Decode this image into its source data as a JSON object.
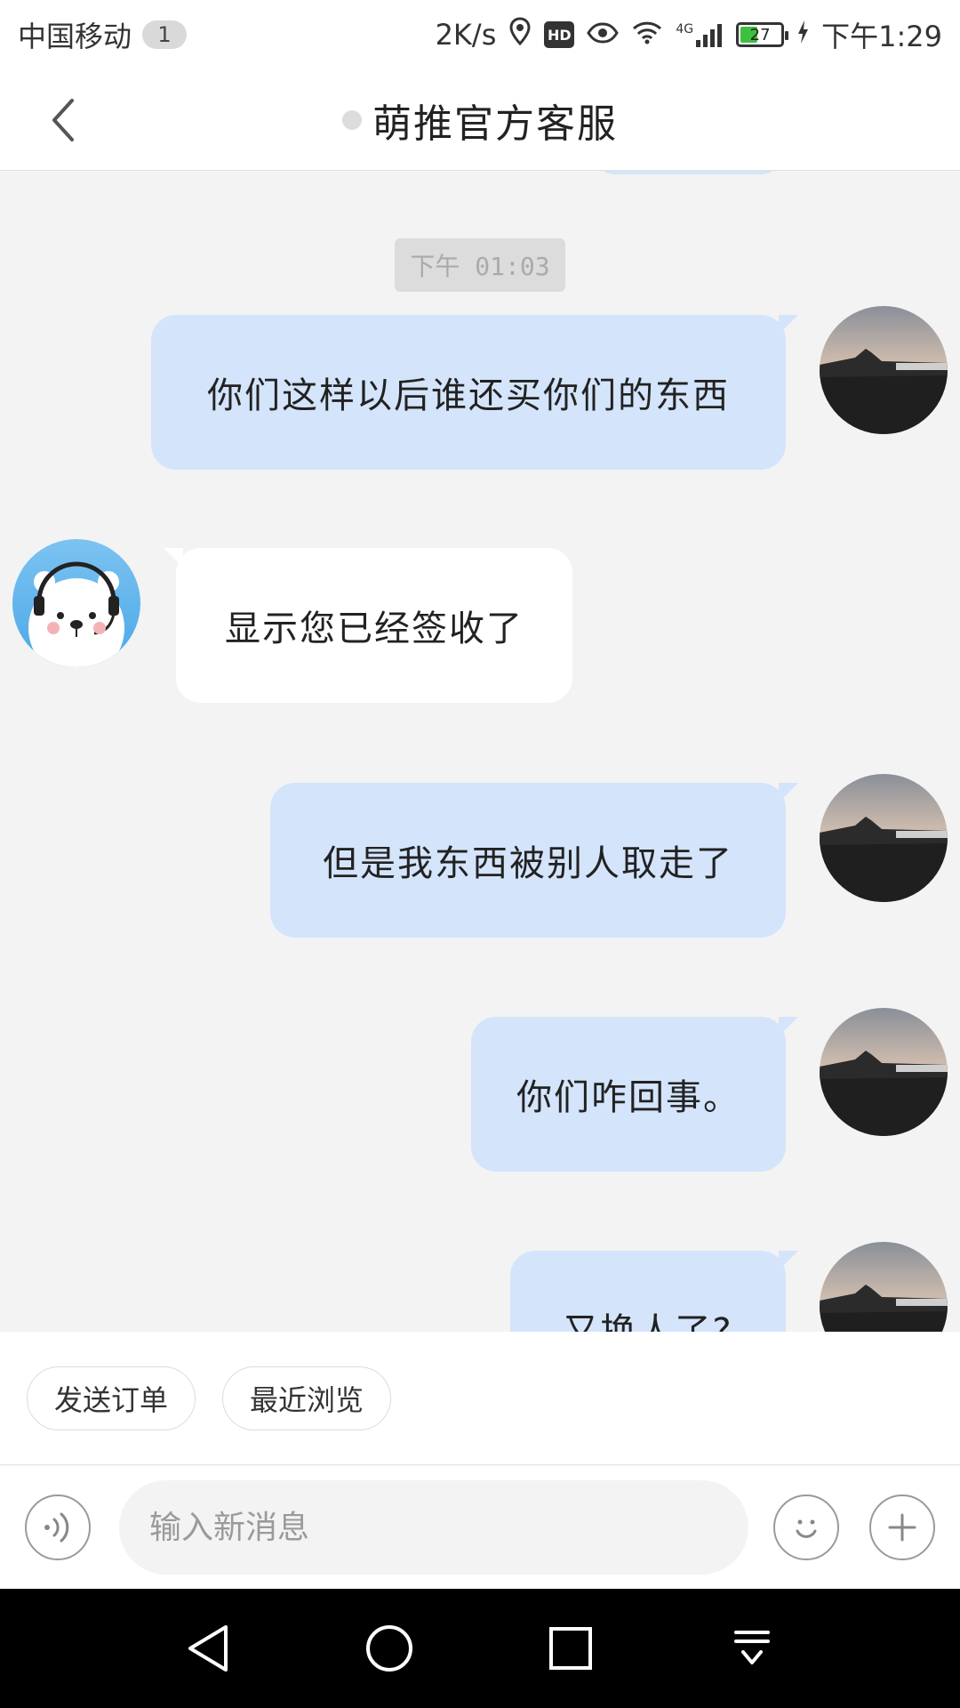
{
  "status_bar": {
    "carrier": "中国移动",
    "sim_badge": "1",
    "net_speed": "2K/s",
    "hd": "HD",
    "network": "4G",
    "battery": "27",
    "time": "下午1:29"
  },
  "header": {
    "title": "萌推官方客服"
  },
  "chat": {
    "timestamp": "下午 01:03",
    "messages": [
      {
        "from": "me",
        "text": "你们这样以后谁还买你们的东西"
      },
      {
        "from": "them",
        "text": "显示您已经签收了"
      },
      {
        "from": "me",
        "text": "但是我东西被别人取走了"
      },
      {
        "from": "me",
        "text": "你们咋回事。"
      },
      {
        "from": "me",
        "text": "又换人了?"
      }
    ]
  },
  "quick_actions": {
    "send_order": "发送订单",
    "recent_browse": "最近浏览"
  },
  "input": {
    "placeholder": "输入新消息"
  },
  "colors": {
    "my_bubble": "#d4e4fb",
    "their_bubble": "#ffffff",
    "chat_bg": "#f3f3f3",
    "nav_bar": "#000000"
  }
}
